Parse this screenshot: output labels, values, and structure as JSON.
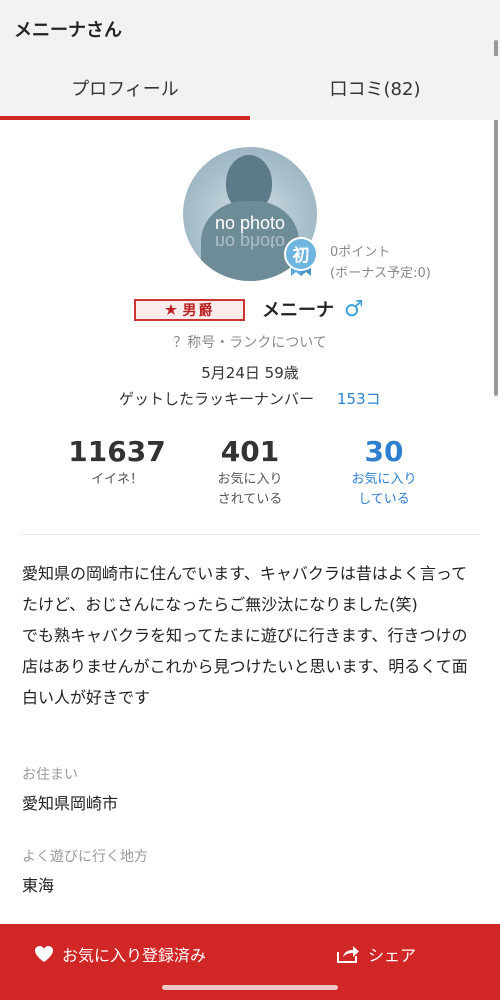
{
  "header": {
    "title": "メニーナさん"
  },
  "tabs": [
    {
      "label": "プロフィール",
      "active": true
    },
    {
      "label": "口コミ(82)",
      "active": false
    }
  ],
  "profile": {
    "avatar_text": "no photo",
    "badge_text": "初",
    "points": "0ポイント",
    "bonus": "(ボーナス予定:0)",
    "title_badge": "男爵",
    "name": "メニーナ",
    "gender_icon": "male-icon",
    "rank_link": "？称号・ランクについて",
    "birthday": "5月24日 59歳",
    "lucky_label": "ゲットしたラッキーナンバー",
    "lucky_count": "153コ"
  },
  "stats": [
    {
      "value": "11637",
      "label_line1": "イイネ！",
      "label_line2": ""
    },
    {
      "value": "401",
      "label_line1": "お気に入り",
      "label_line2": "されている"
    },
    {
      "value": "30",
      "label_line1": "お気に入り",
      "label_line2": "している"
    }
  ],
  "bio": "愛知県の岡崎市に住んでいます、キャバクラは昔はよく言ってたけど、おじさんになったらご無沙汰になりました(笑)\nでも熟キャバクラを知ってたまに遊びに行きます、行きつけの店はありませんがこれから見つけたいと思います、明るくて面白い人が好きです",
  "fields": [
    {
      "label": "お住まい",
      "value": "愛知県岡崎市"
    },
    {
      "label": "よく遊びに行く地方",
      "value": "東海"
    }
  ],
  "bottom": {
    "favorite_label": "お気に入り登録済み",
    "share_label": "シェア"
  },
  "colors": {
    "accent": "#d12626",
    "link": "#2e7fd0",
    "male": "#3aa0d8"
  }
}
